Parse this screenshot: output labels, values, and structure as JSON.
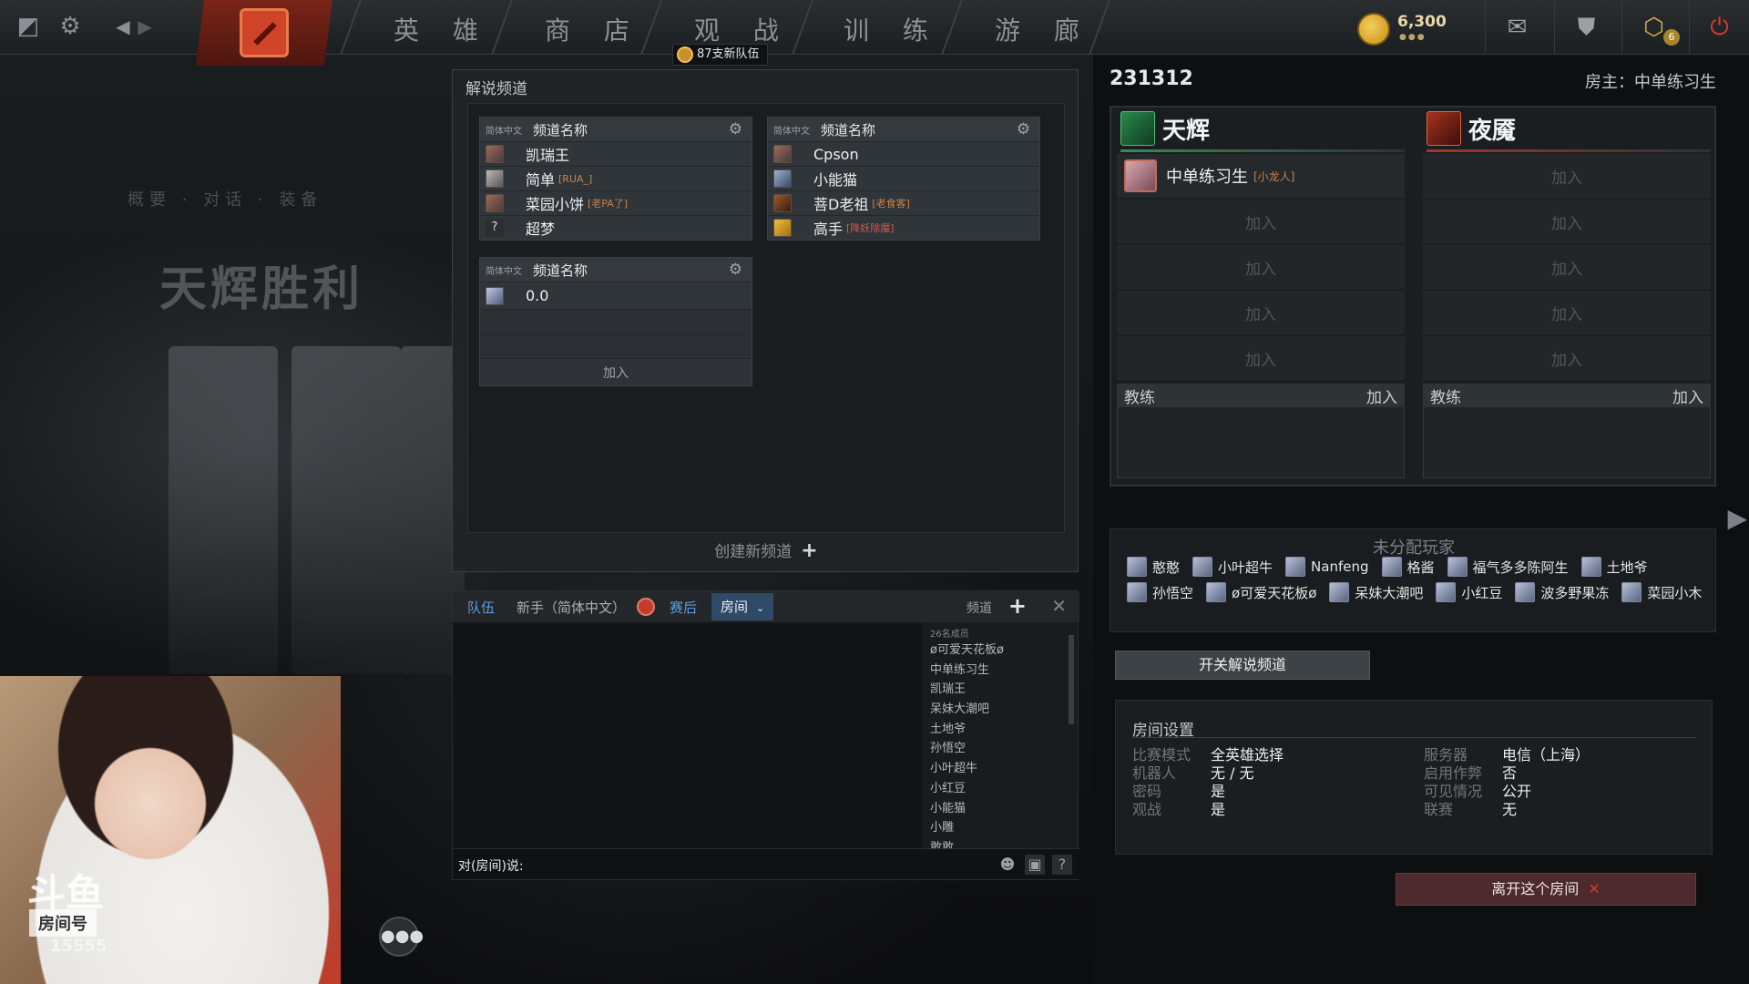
{
  "nav": {
    "tabs": [
      "英 雄",
      "商 店",
      "观 战",
      "训 练",
      "游 廊"
    ],
    "new_team_badge": "87支新队伍",
    "coins": "6,300",
    "coin_dots": "●●●",
    "notif_count": "6"
  },
  "background": {
    "victory_text": "天辉胜利",
    "breadcrumb": "概要 · 对话 · 装备"
  },
  "broadcast": {
    "title": "解说频道",
    "channels": [
      {
        "lang": "简体中文",
        "name": "频道名称",
        "members": [
          {
            "name": "凯瑞王",
            "tag": ""
          },
          {
            "name": "简单",
            "tag": "[RUA_]"
          },
          {
            "name": "菜园小饼",
            "tag": "[老PA了]"
          },
          {
            "name": "超梦",
            "tag": "",
            "unknown": true
          }
        ]
      },
      {
        "lang": "简体中文",
        "name": "频道名称",
        "members": [
          {
            "name": "Cpson",
            "tag": ""
          },
          {
            "name": "小能猫",
            "tag": ""
          },
          {
            "name": "菩D老祖",
            "tag": "[老食客]"
          },
          {
            "name": "高手",
            "tag": "[降妖除魔]"
          }
        ]
      },
      {
        "lang": "简体中文",
        "name": "频道名称",
        "members": [
          {
            "name": "0.0",
            "tag": ""
          }
        ],
        "join_label": "加入"
      }
    ],
    "create_label": "创建新频道"
  },
  "chat": {
    "tabs": {
      "team": "队伍",
      "newbie": "新手（简体中文）",
      "post_game": "赛后",
      "room": "房间"
    },
    "channel_label": "频道",
    "member_count": "26名成员",
    "members": [
      "ø可爱天花板ø",
      "中单练习生",
      "凯瑞王",
      "呆妹大潮吧",
      "土地爷",
      "孙悟空",
      "小叶超牛",
      "小红豆",
      "小能猫",
      "小雕",
      "敢敢"
    ],
    "prompt": "对(房间)说:"
  },
  "lobby": {
    "id": "231312",
    "host": "房主：中单练习生",
    "radiant": {
      "name": "天辉",
      "player": {
        "name": "中单练习生",
        "tag": "[小龙人]"
      },
      "join": "加入"
    },
    "dire": {
      "name": "夜魇",
      "join": "加入"
    },
    "coach_label": "教练",
    "coach_join": "加入",
    "unassigned_title": "未分配玩家",
    "unassigned_row1": [
      "憨憨",
      "小叶超牛",
      "Nanfeng",
      "格酱",
      "福气多多陈阿生",
      "土地爷"
    ],
    "unassigned_row2": [
      "孙悟空",
      "ø可爱天花板ø",
      "呆妹大潮吧",
      "小红豆",
      "波多野果冻",
      "菜园小木"
    ],
    "toggle_broadcast": "开关解说频道",
    "settings": {
      "title": "房间设置",
      "game_mode": {
        "k": "比赛模式",
        "v": "全英雄选择"
      },
      "bots": {
        "k": "机器人",
        "v": "无 / 无"
      },
      "password": {
        "k": "密码",
        "v": "是"
      },
      "spectate": {
        "k": "观战",
        "v": "是"
      },
      "server": {
        "k": "服务器",
        "v": "电信（上海）"
      },
      "cheats": {
        "k": "启用作弊",
        "v": "否"
      },
      "visibility": {
        "k": "可见情况",
        "v": "公开"
      },
      "league": {
        "k": "联赛",
        "v": "无"
      }
    },
    "leave_label": "离开这个房间"
  },
  "webcam": {
    "logo": "斗鱼",
    "room_label": "房间号",
    "room_number": "15555"
  }
}
